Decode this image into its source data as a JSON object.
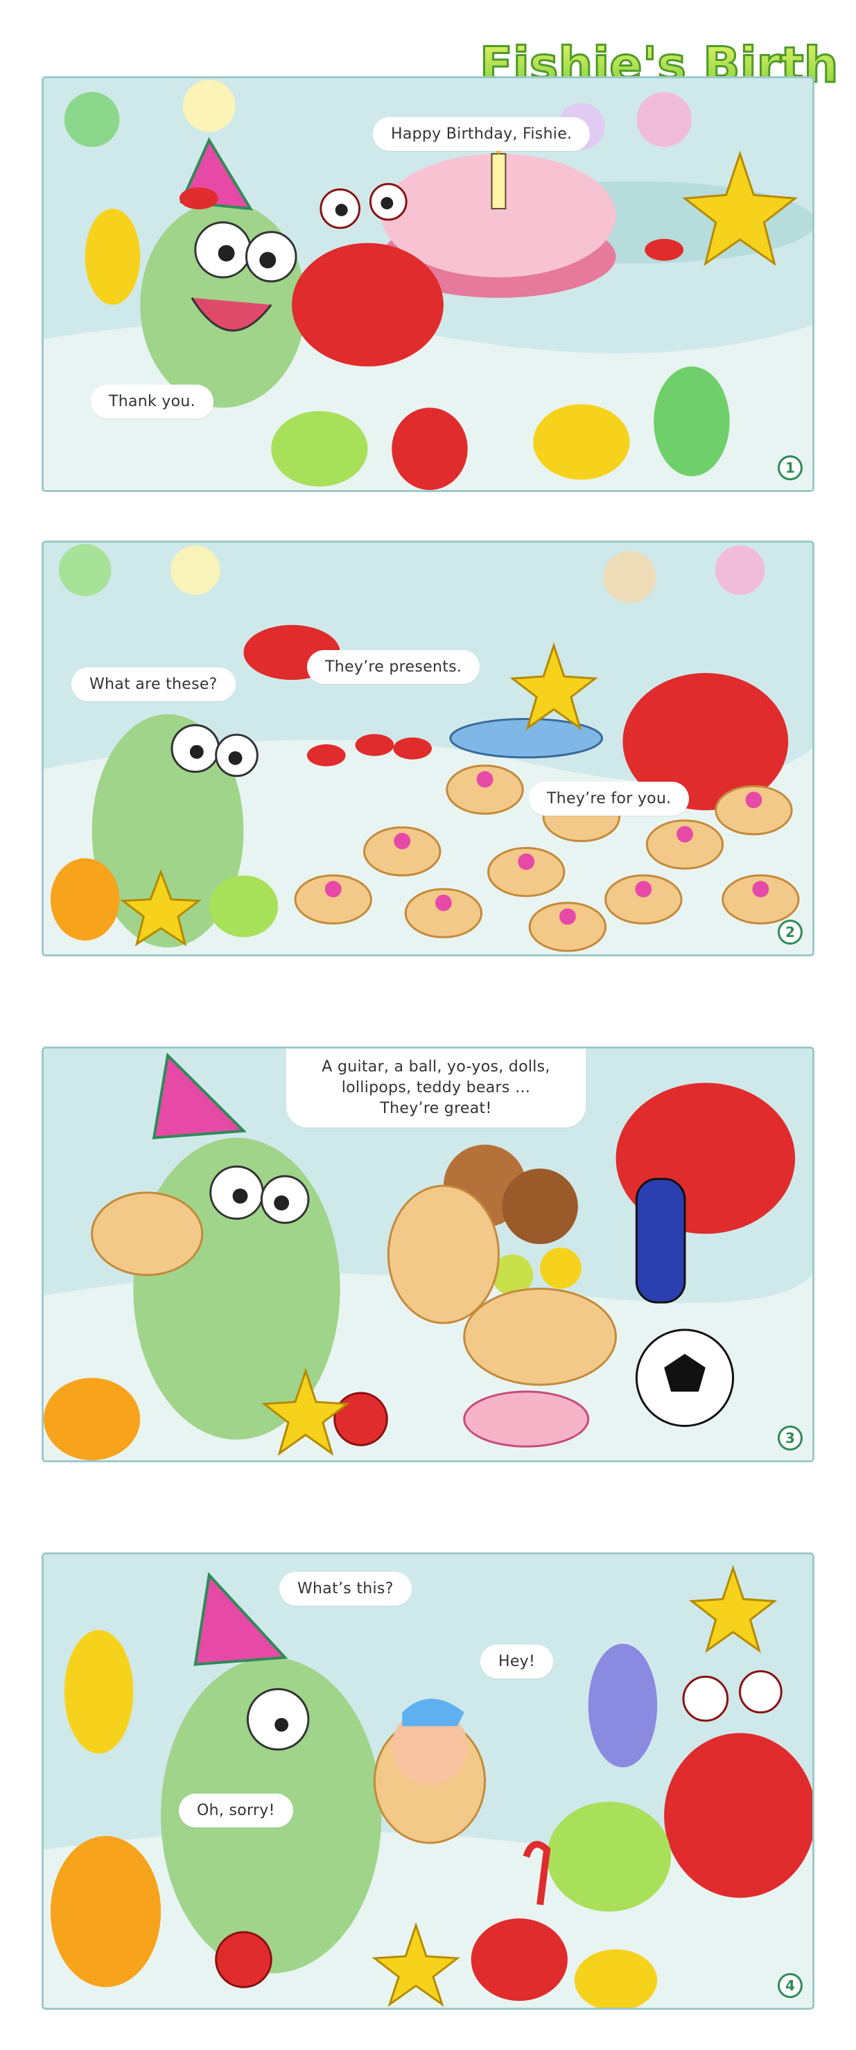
{
  "title": "Fishie's Birthday",
  "colors": {
    "water": "#cfe9ea",
    "sand": "#e8f4f2",
    "fishie": "#9fd48a",
    "crab": "#e02c2c",
    "star": "#f7d21c",
    "shell": "#f3c98a",
    "bow": "#e64aa6",
    "number": "#2e8b57"
  },
  "panels": [
    {
      "number": "1",
      "bubbles": [
        {
          "text": "Happy Birthday, Fishie."
        },
        {
          "text": "Thank you."
        }
      ]
    },
    {
      "number": "2",
      "bubbles": [
        {
          "text": "What are these?"
        },
        {
          "text": "They’re presents."
        },
        {
          "text": "They’re for you."
        }
      ]
    },
    {
      "number": "3",
      "bubbles": [
        {
          "lines": [
            "A guitar, a ball, yo-yos, dolls,",
            "lollipops, teddy bears …",
            "They’re great!"
          ]
        }
      ]
    },
    {
      "number": "4",
      "bubbles": [
        {
          "text": "What’s this?"
        },
        {
          "text": "Hey!"
        },
        {
          "text": "Oh, sorry!"
        }
      ]
    }
  ]
}
